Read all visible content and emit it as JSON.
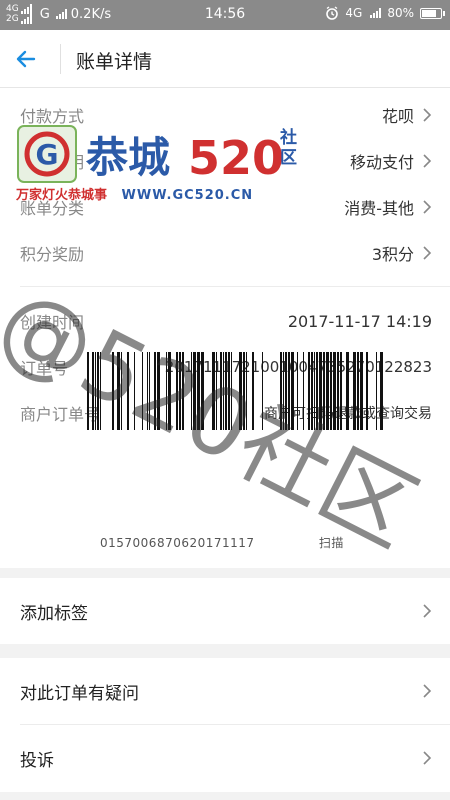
{
  "status_bar": {
    "sim1": "4G",
    "sim2": "2G",
    "carrier_net": "G",
    "speed": "0.2K/s",
    "time": "14:56",
    "right_net": "4G",
    "battery": "80%",
    "battery_level": 0.8
  },
  "header": {
    "title": "账单详情"
  },
  "details": [
    {
      "label": "付款方式",
      "value": "花呗"
    },
    {
      "label": "商品说明",
      "value": "移动支付"
    },
    {
      "label": "账单分类",
      "value": "消费-其他"
    },
    {
      "label": "积分奖励",
      "value": "3积分"
    }
  ],
  "order": {
    "created_label": "创建时间",
    "created_value": "2017-11-17 14:19",
    "order_no_label": "订单号",
    "order_no_value": "2017111721001004735270122823",
    "merchant_label": "商户订单号",
    "merchant_value": "商户可扫码退款或查询交易",
    "barcode_number": "0157006870620171117",
    "barcode_note": "扫描"
  },
  "watermark": {
    "logo_g": "G",
    "logo_name": "恭城",
    "logo_num": "520",
    "logo_community": "社区",
    "slogan": "万家灯火恭城事",
    "url": "WWW.GC520.CN",
    "big": "@520社区"
  },
  "actions": {
    "add_tag": "添加标签",
    "question": "对此订单有疑问",
    "complaint": "投诉"
  },
  "colors": {
    "accent": "#1a8de0",
    "watermark_red": "#d03030",
    "watermark_blue": "#2b5aa8"
  }
}
